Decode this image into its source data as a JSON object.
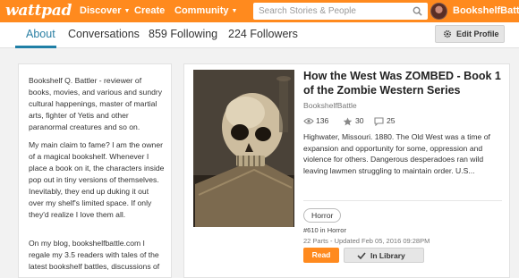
{
  "header": {
    "logo": "wattpad",
    "nav": [
      {
        "label": "Discover",
        "has_caret": true
      },
      {
        "label": "Create",
        "has_caret": false
      },
      {
        "label": "Community",
        "has_caret": true
      }
    ],
    "search_placeholder": "Search Stories & People",
    "username": "BookshelfBatt...",
    "colors": {
      "brand": "#ff8a1e"
    }
  },
  "tabs": {
    "items": [
      "About",
      "Conversations",
      "859 Following",
      "224 Followers"
    ],
    "active": "About",
    "edit_profile": "Edit Profile"
  },
  "about": {
    "paragraphs": [
      "Bookshelf Q. Battler - reviewer of books, movies, and various and sundry cultural happenings, master of martial arts, fighter of Yetis and other paranormal creatures and so on.",
      "My main claim to fame?  I am the owner of a magical bookshelf. Whenever I place a book on it, the characters inside pop out in tiny versions of themselves.  Inevitably, they end up duking it out over my shelf's limited space.  If only they'd realize I love them all.",
      "On my blog, bookshelfbattle.com I regale my 3.5 readers with tales of the latest bookshelf battles, discussions of"
    ]
  },
  "story": {
    "title": "How the West Was ZOMBED - Book 1 of the Zombie Western Series",
    "author": "BookshelfBattle",
    "reads": "136",
    "votes": "30",
    "comments": "25",
    "description": "Highwater, Missouri. 1880. The Old West was a time of expansion and opportunity for some, oppression and violence for others. Dangerous desperadoes ran wild leaving lawmen struggling to maintain order. U.S...",
    "tag": "Horror",
    "rank": "#610 in Horror",
    "parts_updated": "22 Parts - Updated Feb 05, 2016 09:28PM",
    "read_label": "Read",
    "library_label": "In Library"
  }
}
